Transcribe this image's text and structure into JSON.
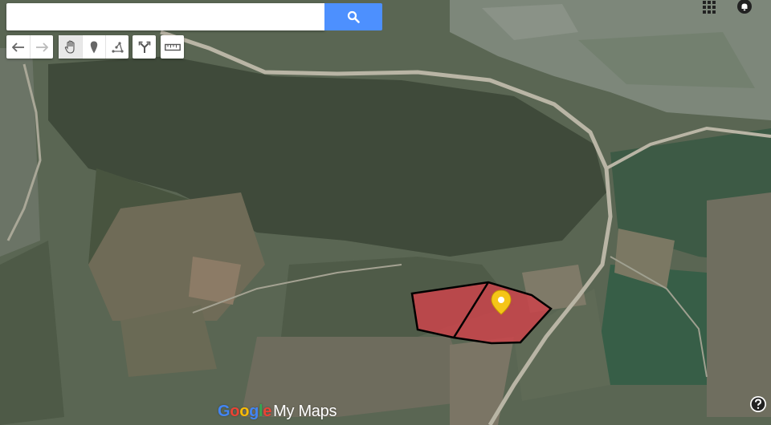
{
  "search": {
    "value": "",
    "placeholder": "",
    "button_icon": "search-icon"
  },
  "toolbar": {
    "history": [
      {
        "icon": "undo-icon"
      },
      {
        "icon": "redo-icon"
      }
    ],
    "tools": [
      {
        "icon": "hand-icon",
        "active": true
      },
      {
        "icon": "marker-icon"
      },
      {
        "icon": "draw-line-icon"
      }
    ],
    "directions": {
      "icon": "directions-icon"
    },
    "measure": {
      "icon": "ruler-icon"
    }
  },
  "logo": {
    "letters": [
      "G",
      "o",
      "o",
      "g",
      "l",
      "e"
    ],
    "brand": "My Maps"
  },
  "map": {
    "type": "satellite",
    "overlays": [
      {
        "type": "polygon",
        "fill": "#c8454b",
        "stroke": "#000000"
      },
      {
        "type": "pin",
        "color": "#f5c518"
      }
    ]
  },
  "colors": {
    "accent": "#4d90fe",
    "polygon_fill": "#c8454b",
    "pin": "#f5c518"
  },
  "top_right": [
    {
      "icon": "apps-grid-icon"
    },
    {
      "icon": "notifications-icon"
    }
  ],
  "help": {
    "icon": "help-icon"
  }
}
